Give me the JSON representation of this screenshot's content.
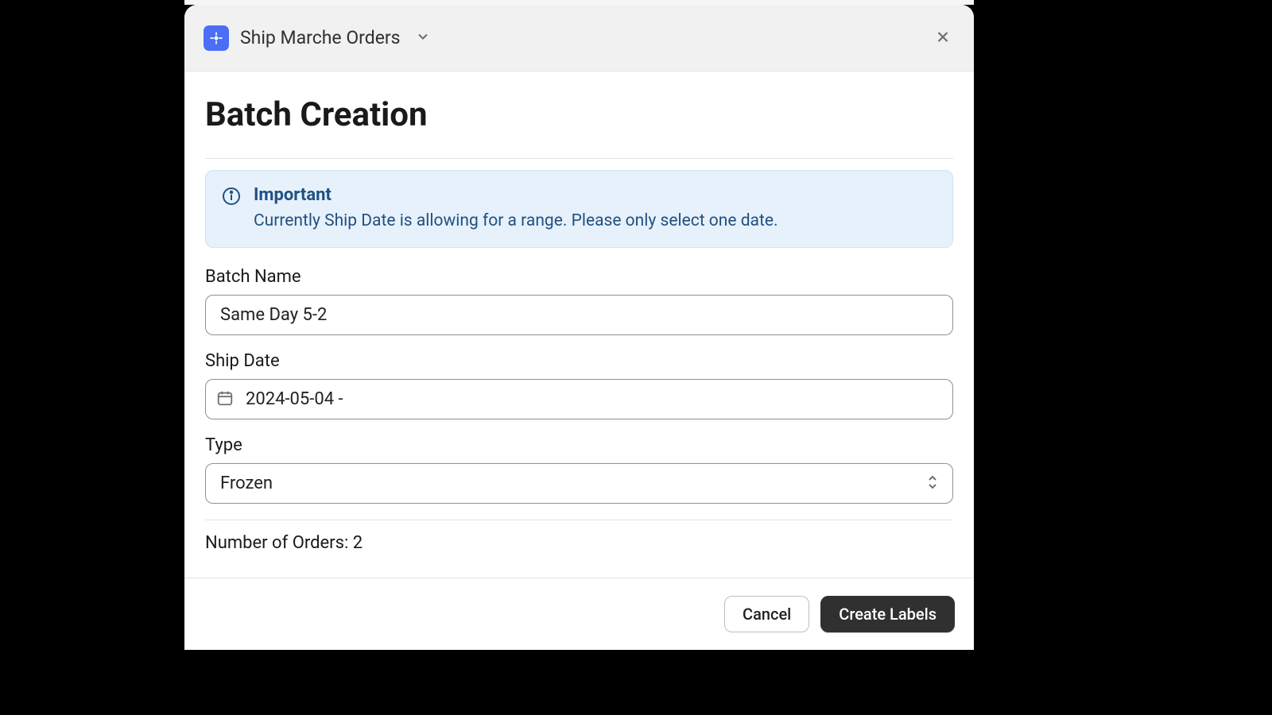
{
  "header": {
    "app_name": "Ship Marche Orders"
  },
  "page_title": "Batch Creation",
  "alert": {
    "title": "Important",
    "body": "Currently Ship Date is allowing for a range. Please only select one date."
  },
  "fields": {
    "batch_name": {
      "label": "Batch Name",
      "value": "Same Day 5-2"
    },
    "ship_date": {
      "label": "Ship Date",
      "value": "2024-05-04 -"
    },
    "type": {
      "label": "Type",
      "value": "Frozen"
    }
  },
  "order_count": {
    "label": "Number of Orders: ",
    "value": "2"
  },
  "buttons": {
    "cancel": "Cancel",
    "create": "Create Labels"
  }
}
